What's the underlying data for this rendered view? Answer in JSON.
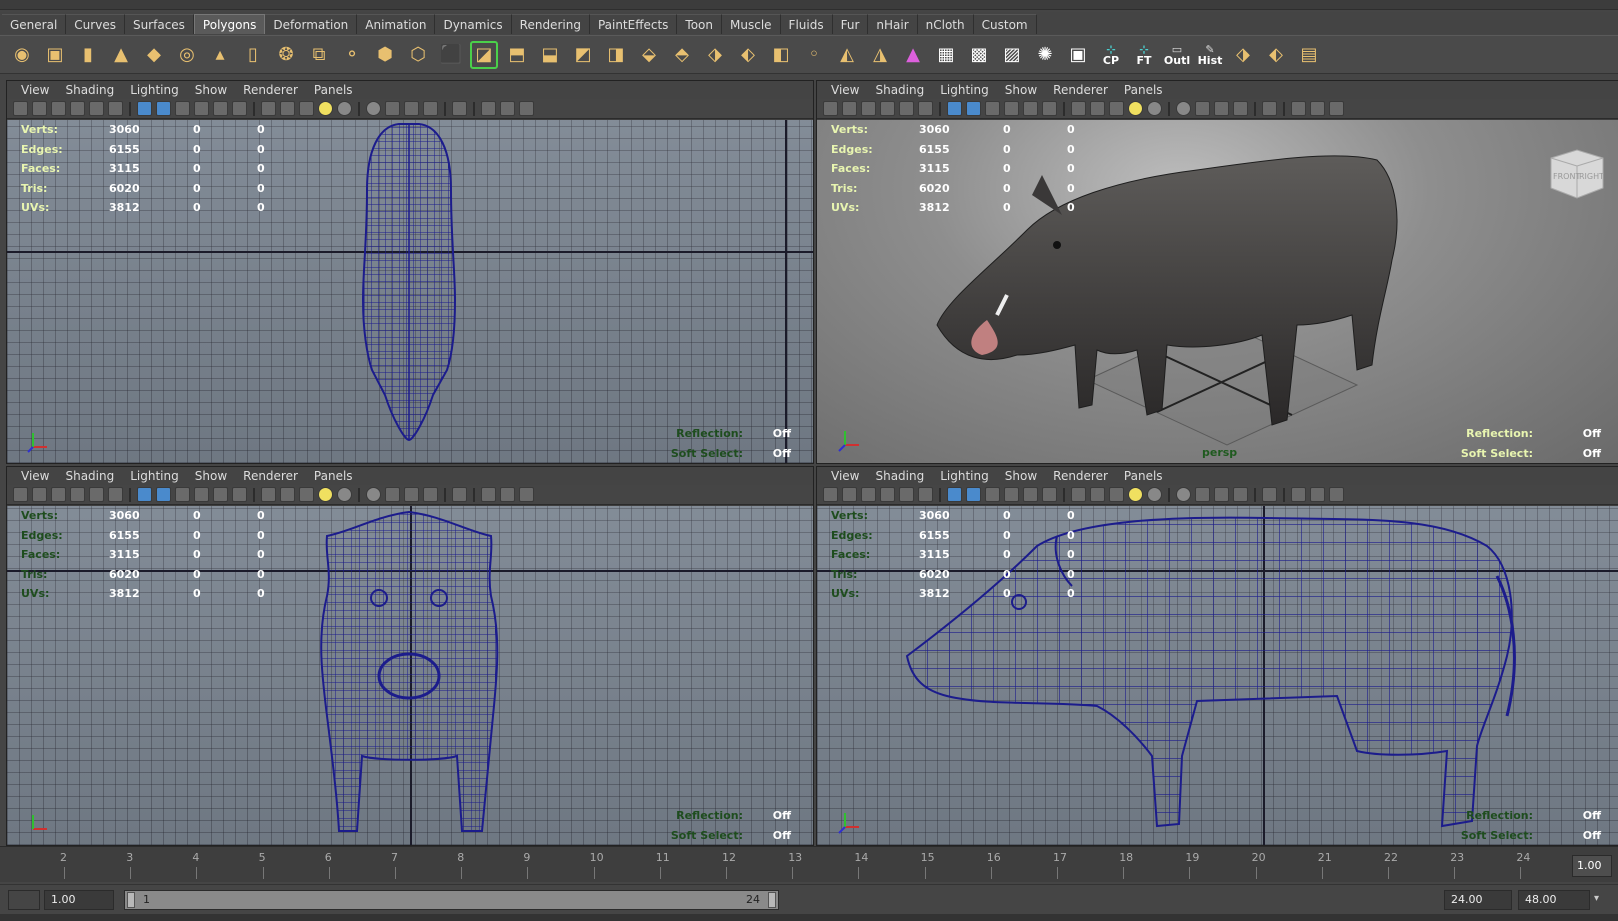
{
  "shelf_tabs": [
    "General",
    "Curves",
    "Surfaces",
    "Polygons",
    "Deformation",
    "Animation",
    "Dynamics",
    "Rendering",
    "PaintEffects",
    "Toon",
    "Muscle",
    "Fluids",
    "Fur",
    "nHair",
    "nCloth",
    "Custom"
  ],
  "active_tab": "Polygons",
  "shelf_text_icons": {
    "cp": "CP",
    "ft": "FT",
    "outl": "Outl",
    "hist": "Hist"
  },
  "viewport_menu": [
    "View",
    "Shading",
    "Lighting",
    "Show",
    "Renderer",
    "Panels"
  ],
  "hud": {
    "labels": [
      "Verts:",
      "Edges:",
      "Faces:",
      "Tris:",
      "UVs:"
    ],
    "values": [
      "3060",
      "6155",
      "3115",
      "6020",
      "3812"
    ],
    "zero": "0"
  },
  "reflection_label": "Reflection:",
  "soft_select_label": "Soft Select:",
  "off_value": "Off",
  "persp_label": "persp",
  "viewcube": {
    "front": "FRONT",
    "right": "RIGHT"
  },
  "axis_labels": {
    "x": "x",
    "y": "y",
    "z": "z"
  },
  "timeline": {
    "ticks": [
      "2",
      "3",
      "4",
      "5",
      "6",
      "7",
      "8",
      "9",
      "10",
      "11",
      "12",
      "13",
      "14",
      "15",
      "16",
      "17",
      "18",
      "19",
      "20",
      "21",
      "22",
      "23",
      "24"
    ],
    "current_frame": "1.00"
  },
  "range": {
    "start": "1.00",
    "slider_start": "1",
    "slider_end": "24",
    "end": "24.00",
    "anim_end": "48.00"
  },
  "colors": {
    "wire": "#1c1c8c",
    "hud_label": "#e8f5b0",
    "ui_bg": "#444444"
  }
}
